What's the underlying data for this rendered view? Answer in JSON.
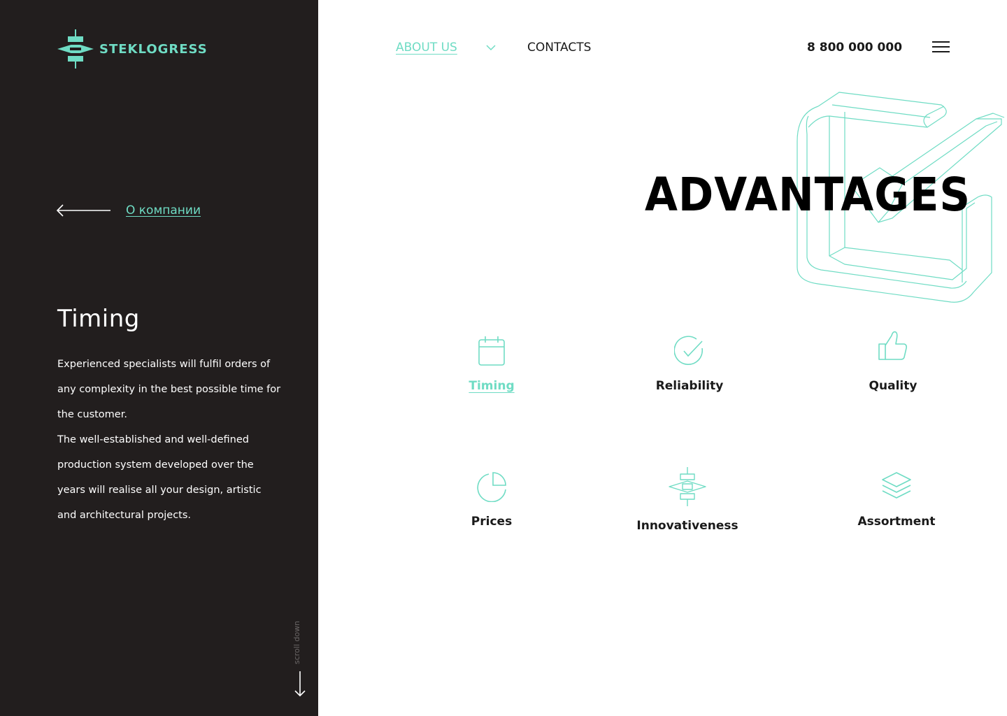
{
  "brand": {
    "name": "STEKLOGRESS",
    "accent": "#6fdcc4",
    "panel_bg": "#221e1e"
  },
  "nav": {
    "about_label": "ABOUT US",
    "contacts_label": "CONTACTS",
    "phone": "8 800 000 000"
  },
  "sidebar": {
    "back_label": "О компании",
    "detail_title": "Timing",
    "detail_text": "Experienced specialists will fulfil orders of any complexity in the best possible time for the customer.\n The well-established and well-defined production system developed over the years will realise all your design, artistic and architectural projects.",
    "scroll_label": "scroll down"
  },
  "page": {
    "title": "ADVANTAGES"
  },
  "advantages": [
    {
      "label": "Timing",
      "icon": "calendar-icon",
      "active": true
    },
    {
      "label": "Reliability",
      "icon": "check-circle-icon",
      "active": false
    },
    {
      "label": "Quality",
      "icon": "thumbs-up-icon",
      "active": false
    },
    {
      "label": "Prices",
      "icon": "pie-chart-icon",
      "active": false
    },
    {
      "label": "Innovativeness",
      "icon": "logo-star-icon",
      "active": false
    },
    {
      "label": "Assortment",
      "icon": "layers-icon",
      "active": false
    }
  ]
}
